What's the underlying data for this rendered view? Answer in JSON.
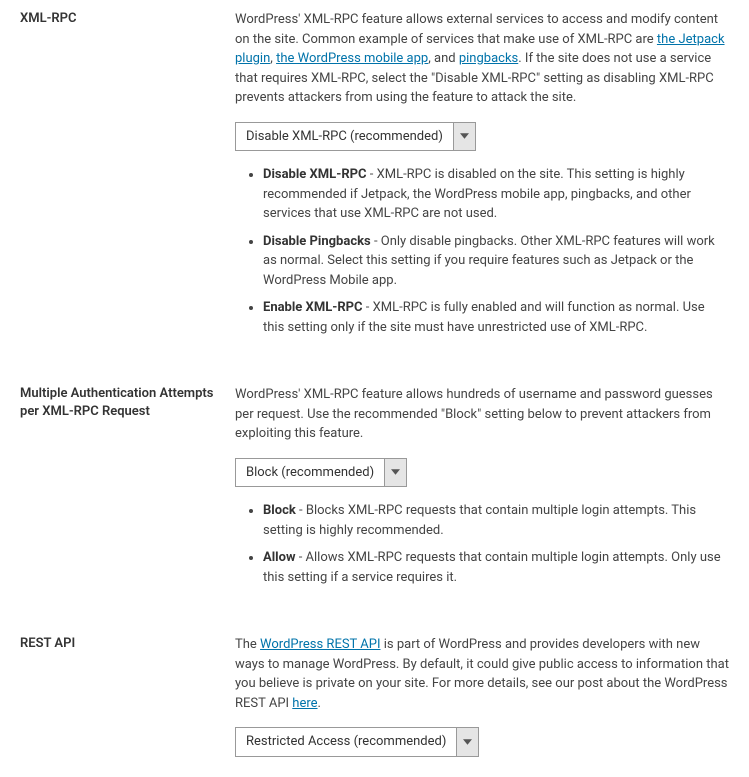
{
  "xmlrpc": {
    "label": "XML-RPC",
    "desc_part1": "WordPress' XML-RPC feature allows external services to access and modify content on the site. Common example of services that make use of XML-RPC are ",
    "link1": "the Jetpack plugin",
    "desc_sep1": ", ",
    "link2": "the WordPress mobile app",
    "desc_sep2": ", and ",
    "link3": "pingbacks",
    "desc_part2": ". If the site does not use a service that requires XML-RPC, select the \"Disable XML-RPC\" setting as disabling XML-RPC prevents attackers from using the feature to attack the site.",
    "select_value": "Disable XML-RPC (recommended)",
    "opt1_name": "Disable XML-RPC",
    "opt1_desc": " - XML-RPC is disabled on the site. This setting is highly recommended if Jetpack, the WordPress mobile app, pingbacks, and other services that use XML-RPC are not used.",
    "opt2_name": "Disable Pingbacks",
    "opt2_desc": " - Only disable pingbacks. Other XML-RPC features will work as normal. Select this setting if you require features such as Jetpack or the WordPress Mobile app.",
    "opt3_name": "Enable XML-RPC",
    "opt3_desc": " - XML-RPC is fully enabled and will function as normal. Use this setting only if the site must have unrestricted use of XML-RPC."
  },
  "multiauth": {
    "label": "Multiple Authentication Attempts per XML-RPC Request",
    "desc": "WordPress' XML-RPC feature allows hundreds of username and password guesses per request. Use the recommended \"Block\" setting below to prevent attackers from exploiting this feature.",
    "select_value": "Block (recommended)",
    "opt1_name": "Block",
    "opt1_desc": " - Blocks XML-RPC requests that contain multiple login attempts. This setting is highly recommended.",
    "opt2_name": "Allow",
    "opt2_desc": " - Allows XML-RPC requests that contain multiple login attempts. Only use this setting if a service requires it."
  },
  "restapi": {
    "label": "REST API",
    "desc_part1": "The ",
    "link1": "WordPress REST API",
    "desc_part2": " is part of WordPress and provides developers with new ways to manage WordPress. By default, it could give public access to information that you believe is private on your site. For more details, see our post about the WordPress REST API ",
    "link2": "here",
    "desc_part3": ".",
    "select_value": "Restricted Access (recommended)"
  }
}
